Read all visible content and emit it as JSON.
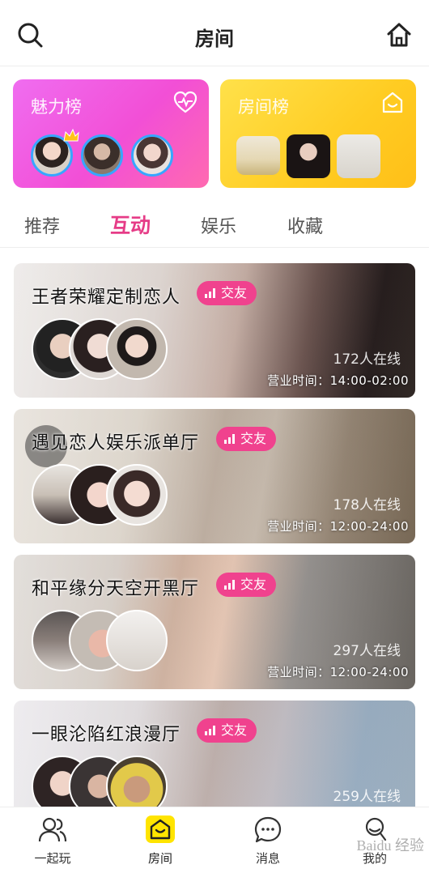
{
  "header": {
    "title": "房间",
    "search_icon": "search-icon",
    "home_icon": "home-icon"
  },
  "ranks": {
    "charm": {
      "label": "魅力榜",
      "icon": "heart-pulse-icon",
      "color": "#f24fd6"
    },
    "room": {
      "label": "房间榜",
      "icon": "room-icon",
      "color": "#ffcc22"
    }
  },
  "tabs": [
    {
      "label": "推荐",
      "active": false
    },
    {
      "label": "互动",
      "active": true
    },
    {
      "label": "娱乐",
      "active": false
    },
    {
      "label": "收藏",
      "active": false
    }
  ],
  "rooms": [
    {
      "name": "王者荣耀定制恋人",
      "tag": "交友",
      "online": "172人在线",
      "hours": "营业时间：14:00-02:00"
    },
    {
      "name": "遇见恋人娱乐派单厅",
      "tag": "交友",
      "online": "178人在线",
      "hours": "营业时间：12:00-24:00"
    },
    {
      "name": "和平缘分天空开黑厅",
      "tag": "交友",
      "online": "297人在线",
      "hours": "营业时间：12:00-24:00"
    },
    {
      "name": "一眼沦陷红浪漫厅",
      "tag": "交友",
      "online": "259人在线",
      "hours": ""
    }
  ],
  "bottom_nav": [
    {
      "label": "一起玩",
      "icon": "people-icon",
      "active": false
    },
    {
      "label": "房间",
      "icon": "room-icon",
      "active": true
    },
    {
      "label": "消息",
      "icon": "message-icon",
      "active": false
    },
    {
      "label": "我的",
      "icon": "profile-icon",
      "active": false
    }
  ],
  "colors": {
    "accent": "#e63c87",
    "tag": "#f0428e",
    "nav_active": "#ffe400"
  },
  "watermark": "Baidu 经验"
}
